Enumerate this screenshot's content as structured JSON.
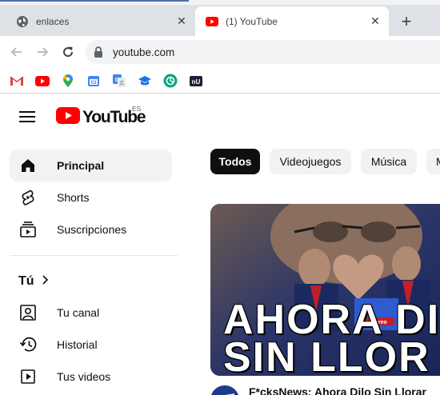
{
  "browser": {
    "tabs": [
      {
        "title": "enlaces",
        "icon": "globe-icon",
        "active": false
      },
      {
        "title": "(1) YouTube",
        "icon": "youtube-icon",
        "active": true
      }
    ],
    "new_tab_label": "+",
    "address": "youtube.com",
    "bookmarks": [
      "gmail-icon",
      "youtube-icon",
      "maps-icon",
      "calendar-icon",
      "translate-icon",
      "classroom-icon",
      "chatgpt-icon",
      "extension-icon"
    ]
  },
  "youtube": {
    "logo_text": "YouTube",
    "region_code": "ES",
    "sidebar": {
      "main": [
        {
          "label": "Principal",
          "icon": "home-icon",
          "active": true
        },
        {
          "label": "Shorts",
          "icon": "shorts-icon",
          "active": false
        },
        {
          "label": "Suscripciones",
          "icon": "subscriptions-icon",
          "active": false
        }
      ],
      "you_header": "Tú",
      "you": [
        {
          "label": "Tu canal",
          "icon": "channel-icon"
        },
        {
          "label": "Historial",
          "icon": "history-icon"
        },
        {
          "label": "Tus videos",
          "icon": "your-videos-icon"
        }
      ]
    },
    "chips": [
      "Todos",
      "Videojuegos",
      "Música",
      "M"
    ],
    "video": {
      "thumbnail_text_line1": "AHORA DI",
      "thumbnail_text_line2": "SIN LLOR",
      "badge_text": "noticreo",
      "title": "F*cksNews: Ahora Dilo Sin Llorar"
    }
  },
  "colors": {
    "youtube_red": "#ff0000",
    "chip_selected": "#0f0f0f",
    "chip_default": "#f2f2f2",
    "tabstrip": "#dee1e6"
  }
}
